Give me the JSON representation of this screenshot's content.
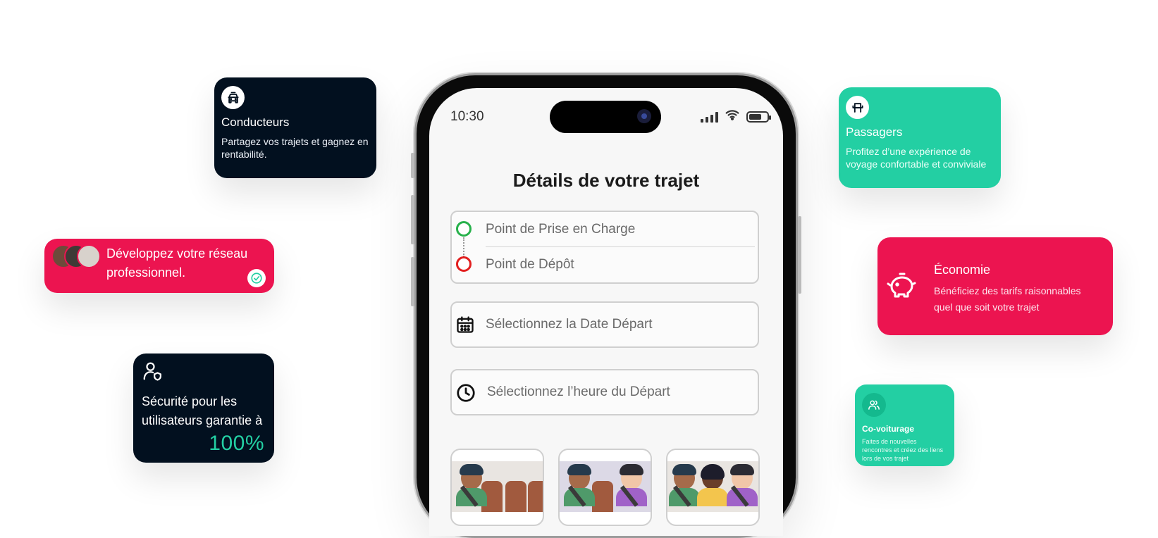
{
  "colors": {
    "dark_card": "#02101f",
    "teal": "#23cfa3",
    "red": "#ec1450",
    "highlight_percent": "#23cfa3"
  },
  "cards": {
    "conducteurs": {
      "icon": "car-icon",
      "title": "Conducteurs",
      "text": "Partagez vos trajets et gagnez en rentabilité."
    },
    "passagers": {
      "icon": "seat-icon",
      "title": "Passagers",
      "text": "Profitez d’une expérience de voyage confortable et conviviale"
    },
    "reseau": {
      "icon": "check-circle-icon",
      "text": "Développez votre réseau professionnel."
    },
    "economie": {
      "icon": "piggy-bank-icon",
      "title": "Économie",
      "text": "Bénéficiez des tarifs raisonnables quel que soit votre trajet"
    },
    "securite": {
      "icon": "user-shield-icon",
      "text": "Sécurité pour les utilisateurs garantie à",
      "percent": "100%"
    },
    "covoiturage": {
      "icon": "users-icon",
      "title": "Co-voiturage",
      "text": "Faites de nouvelles rencontres et créez des liens lors de vos trajet"
    }
  },
  "phone": {
    "time": "10:30",
    "title": "Détails de votre trajet",
    "pickup_placeholder": "Point de Prise en Charge",
    "dropoff_placeholder": "Point de Dépôt",
    "date_placeholder": "Sélectionnez la Date Départ",
    "time_placeholder": "Sélectionnez l’heure du Départ"
  }
}
